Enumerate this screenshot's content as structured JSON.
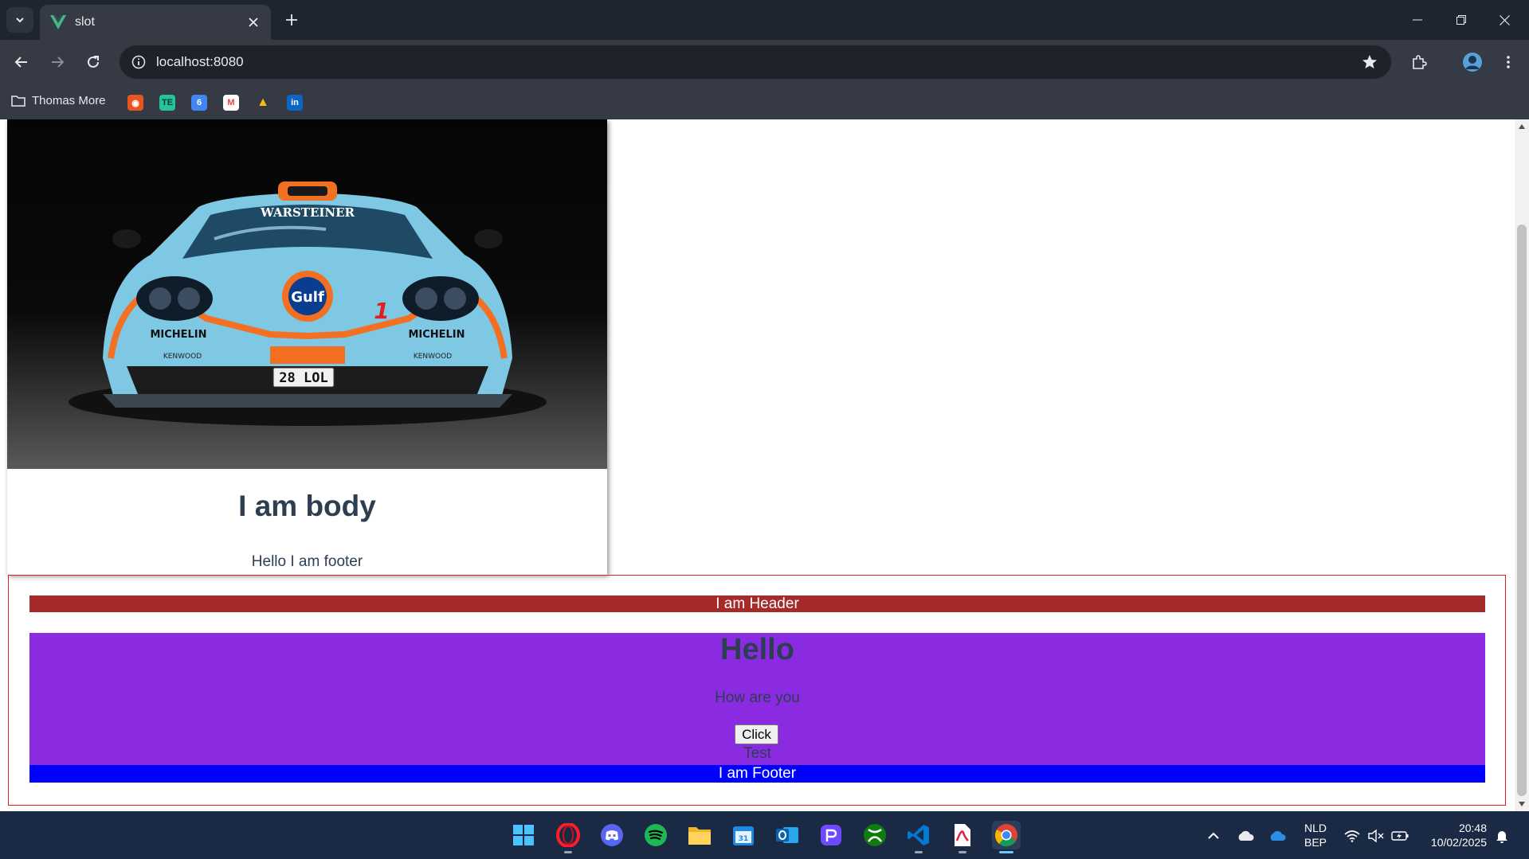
{
  "browser": {
    "tab": {
      "title": "slot",
      "favicon": "vue-logo-icon"
    },
    "address": {
      "url": "localhost:8080"
    },
    "bookmarks": {
      "folder_label": "Thomas More",
      "items": [
        {
          "name": "ubuntu-bookmark-icon",
          "color": "#e95420",
          "glyph": "◉"
        },
        {
          "name": "te-bookmark-icon",
          "color": "#25c2a0",
          "glyph": "TE"
        },
        {
          "name": "calendar-bookmark-icon",
          "color": "#4285f4",
          "glyph": "6"
        },
        {
          "name": "gmail-bookmark-icon",
          "color": "#ea4335",
          "glyph": "M"
        },
        {
          "name": "drive-bookmark-icon",
          "color": "#34a853",
          "glyph": "▲"
        },
        {
          "name": "linkedin-bookmark-icon",
          "color": "#0a66c2",
          "glyph": "in"
        }
      ]
    }
  },
  "page": {
    "card": {
      "title": "I am body",
      "footer": "Hello I am footer",
      "image": {
        "plate": "28 LOL",
        "hood_text": "WARSTEINER",
        "sponsor_left": "MICHELIN",
        "sponsor_right": "MICHELIN",
        "sub_left": "KENWOOD",
        "sub_right": "KENWOOD",
        "badge": "Gulf",
        "number": "1",
        "colors": {
          "body": "#7ec8e3",
          "accent": "#f36f21"
        }
      }
    },
    "slot": {
      "header": "I am Header",
      "heading": "Hello",
      "subtext": "How are you",
      "button_label": "Click",
      "test_text": "Test",
      "footer": "I am Footer",
      "colors": {
        "header": "#a52a2a",
        "content": "#8a2be2",
        "footer": "#0000ff",
        "border": "#e02020"
      }
    }
  },
  "taskbar": {
    "apps": [
      {
        "name": "start-icon"
      },
      {
        "name": "opera-icon"
      },
      {
        "name": "discord-icon"
      },
      {
        "name": "spotify-icon"
      },
      {
        "name": "file-explorer-icon"
      },
      {
        "name": "calendar-app-icon"
      },
      {
        "name": "outlook-icon"
      },
      {
        "name": "proton-icon"
      },
      {
        "name": "xbox-icon"
      },
      {
        "name": "vscode-icon"
      },
      {
        "name": "pdf-icon"
      },
      {
        "name": "chrome-icon"
      }
    ],
    "tray": {
      "language": "NLD",
      "layout": "BEP",
      "time": "20:48",
      "date": "10/02/2025"
    }
  }
}
